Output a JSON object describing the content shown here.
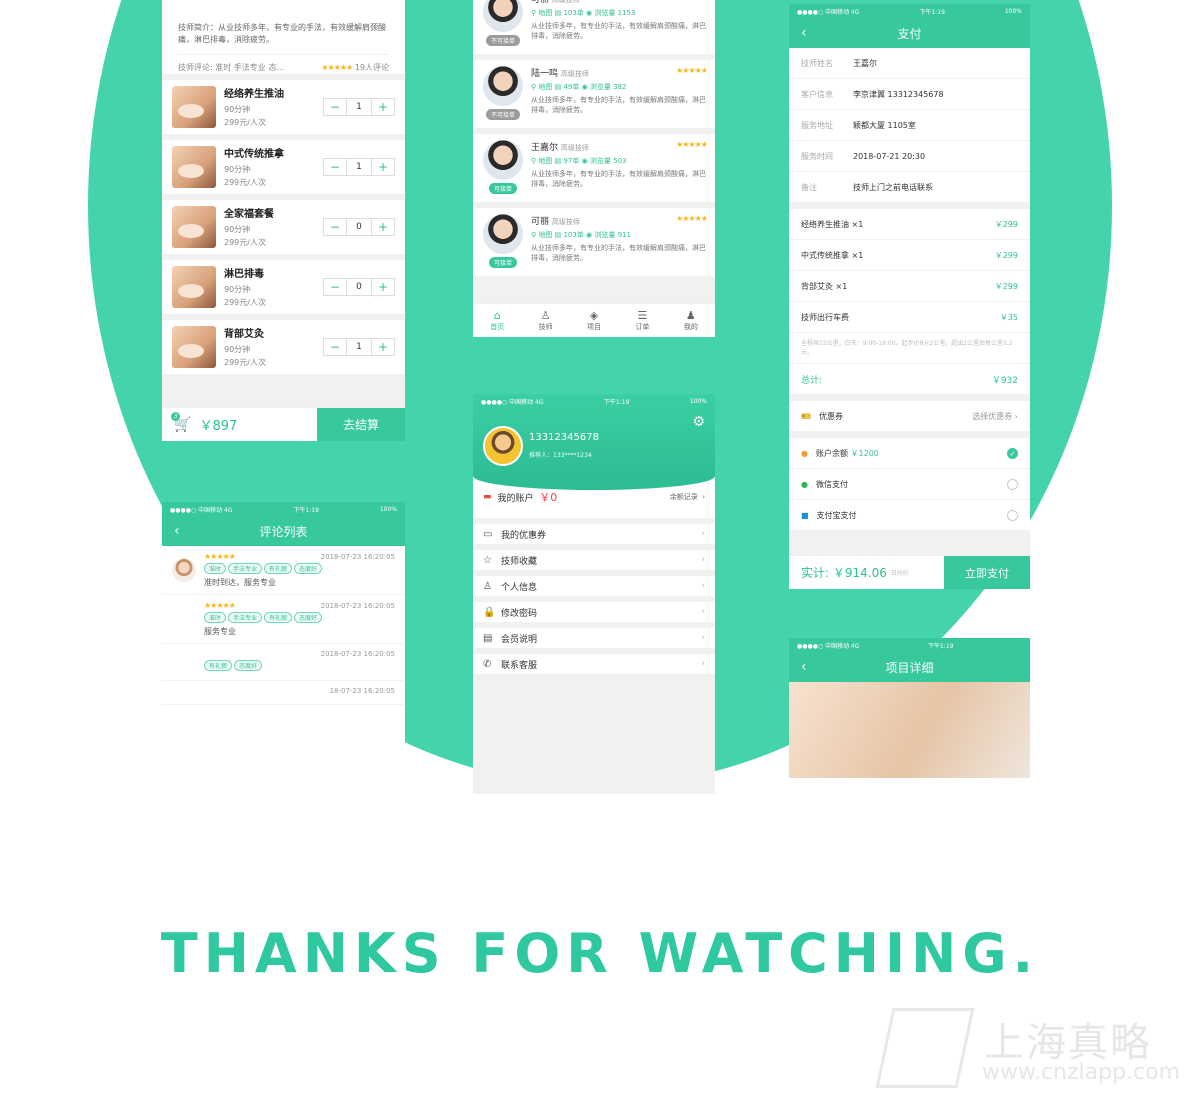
{
  "services_screen": {
    "intro_label": "技师简介：",
    "intro_text": "从业技师多年，有专业的手法，有效缓解肩颈酸痛，淋巴排毒，消除疲劳。",
    "review_label": "技师评论:",
    "review_text": "准时 手法专业 态...",
    "review_count": "19人评论",
    "items": [
      {
        "name": "经络养生推油",
        "duration": "90分钟",
        "price": "299元/人次",
        "qty": "1"
      },
      {
        "name": "中式传统推拿",
        "duration": "90分钟",
        "price": "299元/人次",
        "qty": "1"
      },
      {
        "name": "全家福套餐",
        "duration": "90分钟",
        "price": "299元/人次",
        "qty": "0"
      },
      {
        "name": "淋巴排毒",
        "duration": "90分钟",
        "price": "299元/人次",
        "qty": "0"
      },
      {
        "name": "背部艾灸",
        "duration": "90分钟",
        "price": "299元/人次",
        "qty": "1"
      }
    ],
    "cart_badge": "3",
    "total": "￥897",
    "checkout": "去结算"
  },
  "tech_screen": {
    "techs": [
      {
        "name": "可丽",
        "level": "高级技师",
        "orders": "103单",
        "views": "浏览量 1153",
        "loc": "地图",
        "desc": "从业技师多年，有专业的手法，有效缓解肩颈酸痛，淋巴排毒，消除疲劳。",
        "badge": "不可接单"
      },
      {
        "name": "陆一鸣",
        "level": "高级技师",
        "orders": "49单",
        "views": "浏览量 382",
        "loc": "地图",
        "desc": "从业技师多年，有专业的手法，有效缓解肩颈酸痛，淋巴排毒，消除疲劳。",
        "badge": "不可接单"
      },
      {
        "name": "王嘉尔",
        "level": "高级技师",
        "orders": "97单",
        "views": "浏览量 503",
        "loc": "地图",
        "desc": "从业技师多年，有专业的手法，有效缓解肩颈酸痛，淋巴排毒，消除疲劳。",
        "badge": "可接单"
      },
      {
        "name": "可丽",
        "level": "高级技师",
        "orders": "103单",
        "views": "浏览量 911",
        "loc": "地图",
        "desc": "从业技师多年，有专业的手法，有效缓解肩颈酸痛，淋巴排毒，消除疲劳。",
        "badge": "可接单"
      }
    ],
    "tabs": [
      "首页",
      "技师",
      "项目",
      "订单",
      "我的"
    ]
  },
  "pay_screen": {
    "status_left": "●●●●○ 中国移动 4G",
    "status_time": "下午1:19",
    "status_right": "100%",
    "title": "支付",
    "info": [
      {
        "k": "技师姓名",
        "v": "王嘉尔"
      },
      {
        "k": "客户信息",
        "v": "李京津翼 13312345678"
      },
      {
        "k": "服务地址",
        "v": "颖都大厦 1105室"
      },
      {
        "k": "服务时间",
        "v": "2018-07-21 20:30"
      },
      {
        "k": "备注",
        "v": "技师上门之前电话联系"
      }
    ],
    "lines": [
      {
        "k": "经络养生推油 ×1",
        "v": "￥299"
      },
      {
        "k": "中式传统推拿 ×1",
        "v": "￥299"
      },
      {
        "k": "背部艾灸 ×1",
        "v": "￥299"
      },
      {
        "k": "技师出行车费",
        "v": "￥35"
      }
    ],
    "fare_note": "全程共15公里。白天：9:00-19:00。起步价8元2公里。超出2公里后每公里2.2元。",
    "total_label": "总计:",
    "total_value": "￥932",
    "coupon_label": "优惠券",
    "coupon_pick": "选择优惠券",
    "balance_label": "账户余额",
    "balance_value": "￥1200",
    "wechat": "微信支付",
    "alipay": "支付宝支付",
    "paid_label": "实计:",
    "paid_value": "￥914.06",
    "paid_note": "日间价",
    "pay_btn": "立即支付"
  },
  "detail_screen": {
    "status_left": "●●●●○ 中国移动 4G",
    "status_time": "下午1:19",
    "title": "项目详细"
  },
  "review_screen": {
    "status_left": "●●●●○ 中国移动 4G",
    "status_time": "下午1:19",
    "status_right": "100%",
    "title": "评论列表",
    "reviews": [
      {
        "time": "2018-07-23 16:20:05",
        "tags": [
          "准时",
          "手法专业",
          "有礼貌",
          "态度好"
        ],
        "text": "准时到达，服务专业"
      },
      {
        "time": "2018-07-23 16:20:05",
        "tags": [
          "准时",
          "手法专业",
          "有礼貌",
          "态度好"
        ],
        "text": "服务专业"
      },
      {
        "time": "2018-07-23 16:20:05",
        "tags": [
          "有礼貌",
          "态度好"
        ],
        "text": ""
      },
      {
        "time": "18-07-23 16:20:05",
        "tags": [],
        "text": ""
      }
    ]
  },
  "profile_screen": {
    "status_left": "●●●●○ 中国移动 4G",
    "status_time": "下午1:19",
    "status_right": "100%",
    "phone": "13312345678",
    "referrer": "推荐人：133****1234",
    "account_label": "我的账户",
    "account_value": "￥0",
    "balance_record": "余额记录",
    "menu": [
      "我的优惠券",
      "技师收藏",
      "个人信息",
      "修改密码",
      "会员说明",
      "联系客服"
    ]
  },
  "footer": {
    "thanks": "THANKS FOR WATCHING.",
    "wm_cn": "上海真略",
    "wm_url": "www.cnzlapp.com"
  },
  "colors": {
    "accent": "#38c89e",
    "circle": "#44d3ab",
    "price": "#2fc295",
    "star": "#f6b61b"
  }
}
